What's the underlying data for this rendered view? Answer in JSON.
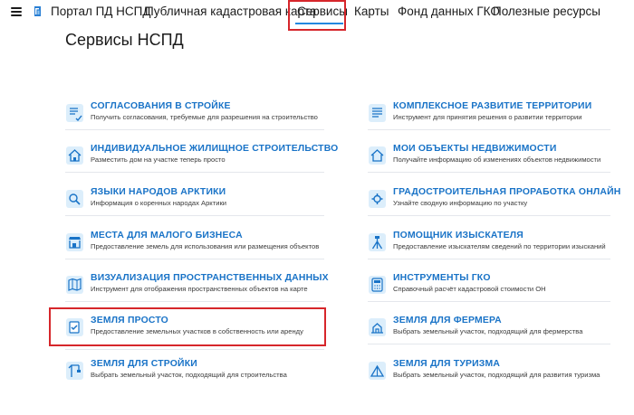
{
  "nav": {
    "items": [
      {
        "label": "Портал ПД НСПД"
      },
      {
        "label": "Публичная кадастровая карта"
      },
      {
        "label": "Сервисы"
      },
      {
        "label": "Карты"
      },
      {
        "label": "Фонд данных ГКО"
      },
      {
        "label": "Полезные ресурсы"
      }
    ],
    "active": "Сервисы"
  },
  "page": {
    "title": "Сервисы НСПД"
  },
  "services": {
    "left": [
      {
        "name": "СОГЛАСОВАНИЯ В СТРОЙКЕ",
        "desc": "Получить согласования, требуемые для разрешения на строительство",
        "icon": "construction-approval-icon"
      },
      {
        "name": "ИНДИВИДУАЛЬНОЕ ЖИЛИЩНОЕ СТРОИТЕЛЬСТВО",
        "desc": "Разместить дом на участке теперь просто",
        "icon": "house-plan-icon"
      },
      {
        "name": "ЯЗЫКИ НАРОДОВ АРКТИКИ",
        "desc": "Информация о коренных народах Арктики",
        "icon": "search-document-icon"
      },
      {
        "name": "МЕСТА ДЛЯ МАЛОГО БИЗНЕСА",
        "desc": "Предоставление земель для использования или размещения объектов",
        "icon": "shop-icon"
      },
      {
        "name": "ВИЗУАЛИЗАЦИЯ ПРОСТРАНСТВЕННЫХ ДАННЫХ",
        "desc": "Инструмент для отображения пространственных объектов на карте",
        "icon": "map-document-icon"
      },
      {
        "name": "ЗЕМЛЯ ПРОСТО",
        "desc": "Предоставление земельных участков в собственность или аренду",
        "icon": "checked-document-icon"
      },
      {
        "name": "ЗЕМЛЯ ДЛЯ СТРОЙКИ",
        "desc": "Выбрать земельный участок, подходящий для строительства",
        "icon": "crane-document-icon"
      }
    ],
    "right": [
      {
        "name": "КОМПЛЕКСНОЕ РАЗВИТИЕ ТЕРРИТОРИИ",
        "desc": "Инструмент для принятия решения о развитии территории",
        "icon": "territory-document-icon"
      },
      {
        "name": "МОИ ОБЪЕКТЫ НЕДВИЖИМОСТИ",
        "desc": "Получайте информацию об изменениях объектов недвижимости",
        "icon": "property-list-icon"
      },
      {
        "name": "ГРАДОСТРОИТЕЛЬНАЯ ПРОРАБОТКА ОНЛАЙН",
        "desc": "Узнайте сводную информацию по участку",
        "icon": "gear-document-icon"
      },
      {
        "name": "ПОМОЩНИК ИЗЫСКАТЕЛЯ",
        "desc": "Предоставление изыскателям сведений по территории изысканий",
        "icon": "surveyor-tripod-icon"
      },
      {
        "name": "ИНСТРУМЕНТЫ ГКО",
        "desc": "Справочный расчёт кадастровой стоимости ОН",
        "icon": "calculator-document-icon"
      },
      {
        "name": "ЗЕМЛЯ ДЛЯ ФЕРМЕРА",
        "desc": "Выбрать земельный участок, подходящий для фермерства",
        "icon": "farm-document-icon"
      },
      {
        "name": "ЗЕМЛЯ ДЛЯ ТУРИЗМА",
        "desc": "Выбрать земельный участок, подходящий для развития туризма",
        "icon": "tourism-document-icon"
      }
    ]
  },
  "colors": {
    "accent": "#1973c7",
    "highlight": "#d6262b",
    "icon_bg": "#dceefb"
  }
}
